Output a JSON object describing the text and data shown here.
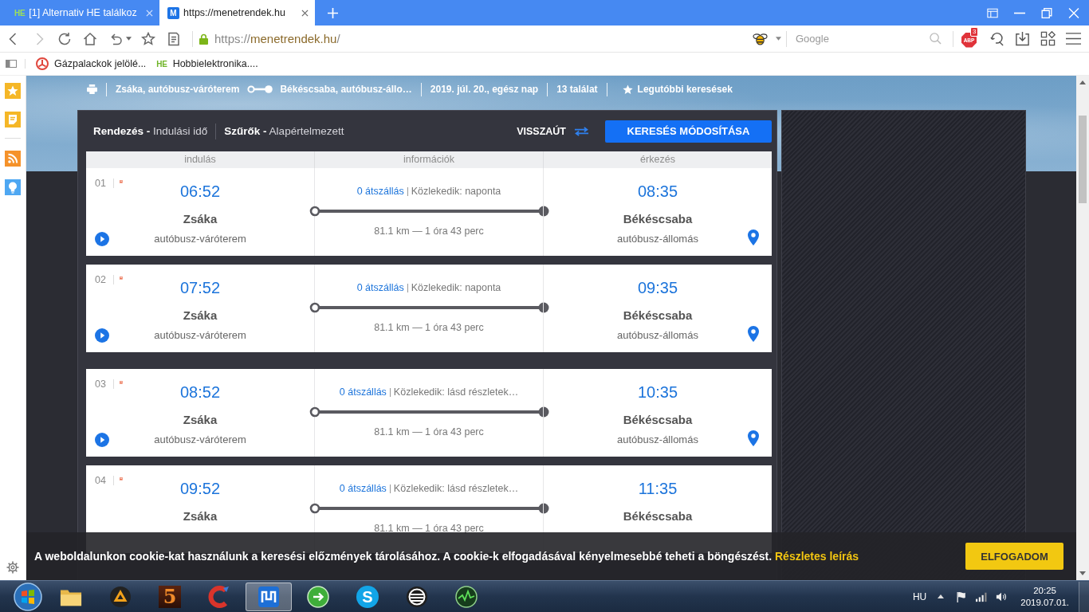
{
  "browser": {
    "tabs": [
      {
        "kind": "text",
        "favicon_text": "HE",
        "title": "[1] Alternativ HE találkoz",
        "selected": false
      },
      {
        "kind": "tile",
        "favicon_text": "M",
        "title": "https://menetrendek.hu",
        "selected": true
      }
    ],
    "nav": {
      "forward_disabled": true
    },
    "address": {
      "scheme": "https://",
      "host": "menetrendek.hu",
      "path": "/"
    },
    "search": {
      "placeholder": "Google"
    },
    "adblock": {
      "label": "ABP",
      "count": "3"
    },
    "bookmarks": [
      {
        "kind": "icon",
        "title": "Gázpalackok jelölé..."
      },
      {
        "kind": "text",
        "favicon_text": "HE",
        "title": "Hobbielektronika...."
      }
    ]
  },
  "summary": {
    "origin": "Zsáka, autóbusz-váróterem",
    "destination": "Békéscsaba, autóbusz-állo…",
    "date": "2019. júl. 20., egész nap",
    "count": "13 találat",
    "recent": "Legutóbbi keresések"
  },
  "toolbar": {
    "sort": "**Rendezés -** Indulási idő",
    "filters": "**Szűrők -** Alapértelmezett",
    "return_trip": "VISSZAÚT",
    "modify": "KERESÉS MÓDOSÍTÁSA"
  },
  "table": {
    "columns": [
      "indulás",
      "információk",
      "érkezés"
    ],
    "rows": [
      {
        "number": "01",
        "departure": "06:52",
        "from": "Zsáka",
        "from_stop": "autóbusz-váróterem",
        "transfers": "0 átszállás",
        "schedule": "Közlekedik: naponta",
        "distance": "81.1 km — 1 óra 43 perc",
        "arrival": "08:35",
        "to": "Békéscsaba",
        "to_stop": "autóbusz-állomás"
      },
      {
        "number": "02",
        "departure": "07:52",
        "from": "Zsáka",
        "from_stop": "autóbusz-váróterem",
        "transfers": "0 átszállás",
        "schedule": "Közlekedik: naponta",
        "distance": "81.1 km — 1 óra 43 perc",
        "arrival": "09:35",
        "to": "Békéscsaba",
        "to_stop": "autóbusz-állomás"
      },
      {
        "number": "03",
        "departure": "08:52",
        "from": "Zsáka",
        "from_stop": "autóbusz-váróterem",
        "transfers": "0 átszállás",
        "schedule": "Közlekedik: lásd részletek…",
        "distance": "81.1 km — 1 óra 43 perc",
        "arrival": "10:35",
        "to": "Békéscsaba",
        "to_stop": "autóbusz-állomás"
      },
      {
        "number": "04",
        "departure": "09:52",
        "from": "Zsáka",
        "transfers": "0 átszállás",
        "schedule": "Közlekedik: lásd részletek…",
        "distance": "81.1 km — 1 óra 43 perc",
        "arrival": "11:35",
        "to": "Békéscsaba"
      }
    ]
  },
  "cookie_bar": {
    "text": "A weboldalunkon cookie-kat használunk a keresési előzmények tárolásához. A cookie-k elfogadásával kényelmesebbé teheti a böngészést.",
    "link": "Részletes leírás",
    "button": "ELFOGADOM"
  },
  "taskbar": {
    "apps": [
      {
        "kind": "folder",
        "selected": false
      },
      {
        "kind": "player",
        "selected": false
      },
      {
        "kind": "tile",
        "label": "5",
        "selected": false
      },
      {
        "kind": "cleaner",
        "selected": false
      },
      {
        "kind": "browser",
        "selected": true
      },
      {
        "kind": "green",
        "selected": false
      },
      {
        "kind": "chat",
        "label": "S",
        "selected": false
      },
      {
        "kind": "ring",
        "selected": false
      },
      {
        "kind": "radar",
        "selected": false
      }
    ],
    "language": "HU",
    "time": "20:25",
    "date": "2019.07.01."
  }
}
